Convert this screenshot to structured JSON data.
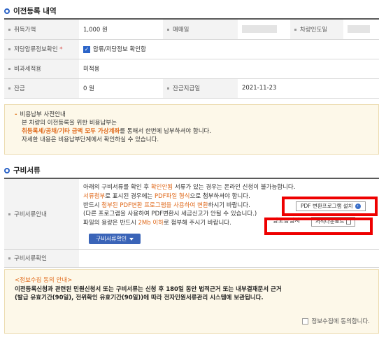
{
  "transfer": {
    "title": "이전등록 내역",
    "acq_price_label": "취득가액",
    "acq_price_value": "1,000 원",
    "seller_label": "매매일",
    "delivery_label": "차량인도일",
    "lien_label": "저당압류정보확인",
    "lien_required_mark": "*",
    "lien_check_label": "압류/저당정보 확인함",
    "tax_label": "비과세적용",
    "tax_value": "미적용",
    "balance_label": "잔금",
    "balance_value": "0 원",
    "balance_date_label": "잔금지급일",
    "balance_date_value": "2021-11-23"
  },
  "fee_notice": {
    "title": "비용납부 사전안내",
    "line1": "본 차량의 이전등록을 위한 비용납부는",
    "line2_emph": "취등록세/공채/기타 금액 모두 가상계좌",
    "line2_rest": "를 통해서 한번에 납부하셔야 합니다.",
    "line3": "자세한 내용은 비용납부단계에서 확인하실 수 있습니다."
  },
  "docs": {
    "title": "구비서류",
    "guide_label": "구비서류안내",
    "confirm_label": "구비서류확인",
    "g1_a": "아래의 구비서류를 확인 후 ",
    "g1_b": "확인안됨",
    "g1_c": " 서류가 있는 경우는 온라인 신청이 불가능합니다.",
    "g2_a": "서류첨부",
    "g2_b": "로 표시된 경우에는 ",
    "g2_c": "PDF파일 형식",
    "g2_d": "으로 첨부하셔야 합니다.",
    "g3_a": "반드시 ",
    "g3_b": "첨부된 PDF변환 프로그램을 사용하여 변환",
    "g3_c": "하시기 바랍니다.",
    "g4": "(다른 프로그램을 사용하여 PDF변환시 세금신고가 안될 수 있습니다.)",
    "g5_a": "파일의 용량은 반드시 ",
    "g5_b": "2Mb 이하",
    "g5_c": "로 첨부해 주시기 바랍니다.",
    "pdf_button": "PDF 변환프로그램 설치",
    "cert_label": "양도증명서",
    "download_button": "서식다운로드",
    "check_button": "구비서류확인"
  },
  "consent": {
    "heading": "<정보수집 동의 안내>",
    "line1": "이전등록신청과 관련된 민원신청서 또는 구비서류는 신청 후 180일 동안 법적근거 또는 내부결재문서 근거",
    "line2": "(발급 유효기간(90일), 전위확인 유효기간(90일))에 따라 전자민원서류관리 시스템에 보관됩니다.",
    "agree_label": "정보수집에 동의합니다."
  }
}
